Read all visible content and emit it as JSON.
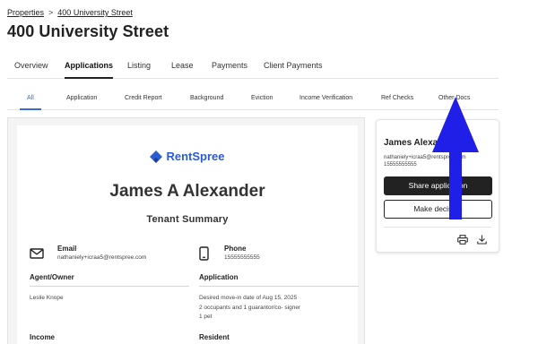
{
  "breadcrumb": {
    "root": "Properties",
    "separator": ">",
    "current": "400 University Street"
  },
  "page_title": "400 University Street",
  "main_tabs": [
    {
      "label": "Overview",
      "active": false
    },
    {
      "label": "Applications",
      "active": true
    },
    {
      "label": "Listing",
      "active": false
    },
    {
      "label": "Lease",
      "active": false
    },
    {
      "label": "Payments",
      "active": false
    },
    {
      "label": "Client Payments",
      "active": false
    }
  ],
  "sub_tabs": [
    {
      "label": "All",
      "active": true
    },
    {
      "label": "Application",
      "active": false
    },
    {
      "label": "Credit Report",
      "active": false
    },
    {
      "label": "Background",
      "active": false
    },
    {
      "label": "Eviction",
      "active": false
    },
    {
      "label": "Income Verification",
      "active": false
    },
    {
      "label": "Ref Checks",
      "active": false
    },
    {
      "label": "Other Docs",
      "active": false
    }
  ],
  "report": {
    "logo_text": "RentSpree",
    "applicant_name": "James A Alexander",
    "summary_title": "Tenant Summary",
    "email_label": "Email",
    "email_value": "nathaniely+icraa5@rentspree.com",
    "phone_label": "Phone",
    "phone_value": "15555555555",
    "agent_label": "Agent/Owner",
    "agent_value": "Leslie Knope",
    "application_label": "Application",
    "application_lines": [
      "Desired move-in date of Aug 15, 2025",
      "2 occupants and 1 guarantor/co- signer",
      "1 pet"
    ],
    "income_label": "Income",
    "resident_label": "Resident"
  },
  "side_card": {
    "name": "James Alexander",
    "email": "nathaniely+icraa5@rentspree.com",
    "phone": "15555555555",
    "share_label": "Share application",
    "decision_label": "Make decision"
  },
  "colors": {
    "accent": "#3a6ad6",
    "brand": "#2c5bd1",
    "arrow": "#1f1fe8",
    "dark_button": "#222222"
  },
  "icons": [
    "chevron-right-icon",
    "rentspree-logo-icon",
    "mail-icon",
    "phone-icon",
    "printer-icon",
    "download-icon",
    "up-arrow-annotation"
  ]
}
